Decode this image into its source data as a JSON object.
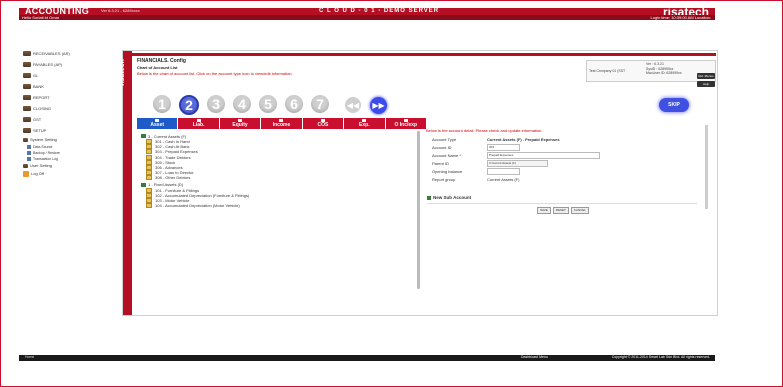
{
  "header": {
    "app_name": "ACCOUNTING",
    "version": "Ver 6.3.21 - 6289xxxx",
    "server": "C L O U D - 0 1 - DEMO SERVER",
    "brand": "risatech",
    "user_greeting": "Hello Suriati bt Omar",
    "login_time": "Login time: 10:39:00 AM   Location:"
  },
  "sidebar": {
    "items": [
      {
        "label": "RECEIVABLES (AR)"
      },
      {
        "label": "PAYABLES (AP)"
      },
      {
        "label": "GL"
      },
      {
        "label": "BANK"
      },
      {
        "label": "REPORT"
      },
      {
        "label": "CLOSING"
      },
      {
        "label": "GST"
      },
      {
        "label": "SETUP"
      }
    ],
    "sub_items": [
      {
        "label": "System Setting"
      },
      {
        "label": "Data Source"
      },
      {
        "label": "Backup / Restore"
      },
      {
        "label": "Transaction Log"
      }
    ],
    "user_setting": "User Setting",
    "logoff": "Log Off"
  },
  "panel": {
    "side_tab": "risatech",
    "title": "FINANCIALS. Config",
    "subtitle": "Chart of Account List",
    "hint": "Below is the chart of account list. Click on the account type icon to view/edit information.",
    "company": "Test Company 01 (SST",
    "version_info": [
      "Ver : 6.3.21",
      "SysID : 628959xx",
      "MacUser ID: 628959xx"
    ],
    "refresh_label": "Ref. Menus",
    "help_label": "Help"
  },
  "wizard": {
    "steps": [
      "1",
      "2",
      "3",
      "4",
      "5",
      "6",
      "7"
    ],
    "active_step": "2",
    "prev_icon": "rewind-icon",
    "next_icon": "fast-forward-icon",
    "skip_label": "SKIP"
  },
  "tabs": [
    {
      "label": "Asset",
      "active": true
    },
    {
      "label": "Liab."
    },
    {
      "label": "Equity"
    },
    {
      "label": "Income"
    },
    {
      "label": "COS"
    },
    {
      "label": "Exp."
    },
    {
      "label": "O Inc/exp"
    }
  ],
  "tree": {
    "groups": [
      {
        "head": "3 - Current Assets (F)",
        "items": [
          "301 - Cash In Hand",
          "302 - Cash At Bank",
          "303 - Prepaid Expenses",
          "304 - Trade Debtors",
          "305 - Stock",
          "306 - Advances",
          "307 - Loan to Director",
          "308 - Other Debtors"
        ]
      },
      {
        "head": "1 - Fixed Assets (D)",
        "items": [
          "101 - Furniture & Fittings",
          "102 - Accumulated Depreciation (Furniture & Fittings)",
          "103 - Motor Vehicle",
          "104 - Accumulated Depreciation (Motor Vehicle)"
        ]
      }
    ]
  },
  "detail": {
    "hint": "Below is the account detail. Please check and update information.",
    "account_type_label": "Account Type",
    "account_type_value": "Current Assets (F) . Prepaid Expenses",
    "account_id_label": "Account ID",
    "account_id_value": "303",
    "account_name_label": "Account Name *",
    "account_name_value": "Prepaid Expenses",
    "parent_id_label": "Parent ID",
    "parent_id_value": "3 Current Assets (F)",
    "opening_balance_label": "Opening balance",
    "opening_balance_value": "",
    "report_group_label": "Report group",
    "report_group_value": "Current Assets (F)",
    "new_sub_label": "New Sub Account",
    "buttons": [
      "SAVE",
      "RESET",
      "CANCEL"
    ]
  },
  "footer": {
    "left": "Home",
    "menu": "Dashboard Menu",
    "copyright": "Copyright © 2011-2014 Smart Lab Sdn Bhd. All rights reserved."
  },
  "colors": {
    "brand_red": "#c8102e",
    "active_blue": "#1e5bc9",
    "wizard_blue": "#4050e0"
  }
}
